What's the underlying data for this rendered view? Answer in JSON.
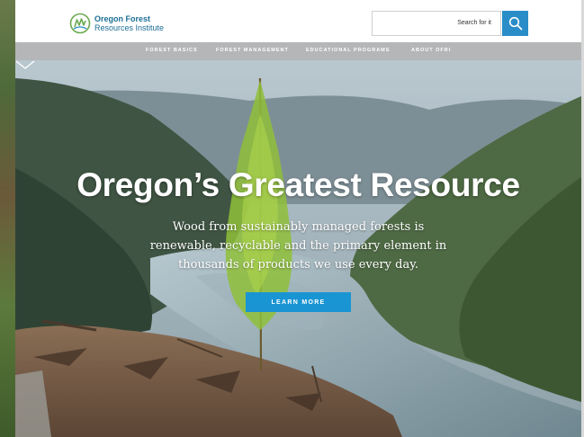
{
  "logo": {
    "line1": "Oregon Forest",
    "line2": "Resources Institute"
  },
  "search": {
    "placeholder": "Search for it",
    "button_icon": "search-icon"
  },
  "nav": {
    "items": [
      "FOREST BASICS",
      "FOREST MANAGEMENT",
      "EDUCATIONAL PROGRAMS",
      "ABOUT OFRI"
    ]
  },
  "hero": {
    "title": "Oregon’s Greatest Resource",
    "subtitle": "Wood from sustainably managed forests is renewable, recyclable and the primary element in thousands of products we use every day.",
    "cta_label": "LEARN MORE",
    "scroll_icon": "chevron-down-icon"
  },
  "colors": {
    "brand_blue": "#2a8dc8",
    "cta_blue": "#1a95d3",
    "nav_gray": "#b4b6b7",
    "logo_green": "#6aa84f"
  }
}
